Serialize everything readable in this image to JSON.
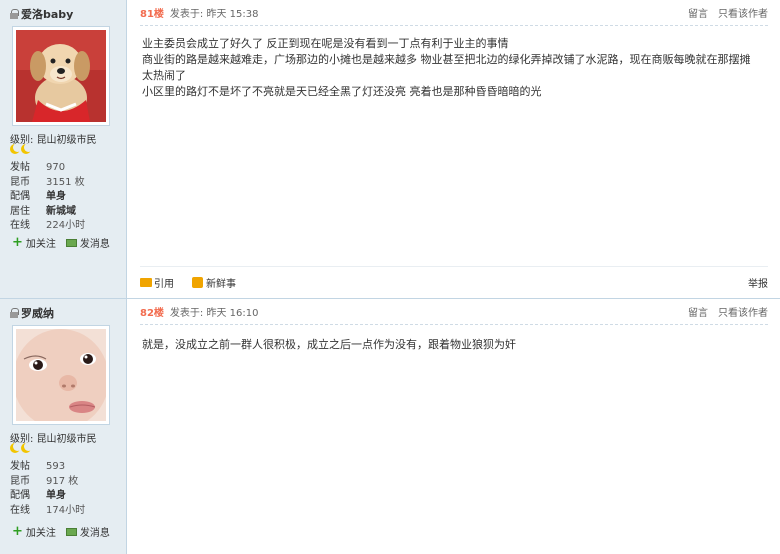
{
  "posts": [
    {
      "username": "爱洛baby",
      "level_label": "级别:",
      "level": "昆山初级市民",
      "stats": [
        {
          "key": "发帖",
          "value": "970"
        },
        {
          "key": "昆币",
          "value": "3151 枚"
        },
        {
          "key": "配偶",
          "value": "单身"
        },
        {
          "key": "居住",
          "value": "新城域"
        },
        {
          "key": "在线",
          "value": "224小时"
        }
      ],
      "follow_label": "加关注",
      "message_label": "发消息",
      "floor": "81楼",
      "time": "发表于: 昨天 15:38",
      "reply_label": "留言",
      "author_only_label": "只看该作者",
      "content": [
        "业主委员会成立了好久了 反正到现在呢是没有看到一丁点有利于业主的事情",
        "商业街的路是越来越难走，广场那边的小摊也是越来越多 物业甚至把北边的绿化弄掉改铺了水泥路，现在商贩每晚就在那摆摊 太热闹了",
        "小区里的路灯不是坏了不亮就是天已经全黑了灯还没亮  亮着也是那种昏昏暗暗的光"
      ],
      "quote_label": "引用",
      "news_label": "新鲜事",
      "report_label": "举报"
    },
    {
      "username": "罗威纳",
      "level_label": "级别:",
      "level": "昆山初级市民",
      "stats": [
        {
          "key": "发帖",
          "value": "593"
        },
        {
          "key": "昆币",
          "value": "917 枚"
        },
        {
          "key": "配偶",
          "value": "单身"
        },
        {
          "key": "在线",
          "value": "174小时"
        }
      ],
      "follow_label": "加关注",
      "message_label": "发消息",
      "floor": "82楼",
      "time": "发表于: 昨天 16:10",
      "reply_label": "留言",
      "author_only_label": "只看该作者",
      "content": [
        "就是，没成立之前一群人很积极，成立之后一点作为没有，跟着物业狼狈为奸"
      ]
    }
  ],
  "colors": {
    "floor": "#f26c4f",
    "sidebar_bg": "#e5edf2",
    "border": "#c2d5e3",
    "moon": "#f2c500"
  }
}
